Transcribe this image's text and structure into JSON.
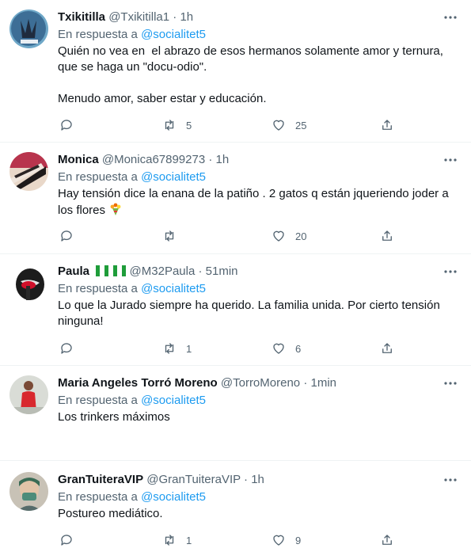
{
  "reply_prefix": "En respuesta a",
  "colors": {
    "mention": "#1d9bf0",
    "secondary": "#536471",
    "text": "#0f1419",
    "divider": "#eff3f4"
  },
  "icons": {
    "reply": "comment-icon",
    "retweet": "retweet-icon",
    "like": "heart-icon",
    "share": "share-icon",
    "more": "more-icon"
  },
  "tweets": [
    {
      "name": "Txikitilla",
      "handle": "@Txikitilla1",
      "sep": "·",
      "time": "1h",
      "mention": "@socialitet5",
      "text": "Quién no vea en  el abrazo de esos hermanos solamente amor y ternura, que se haga un \"docu-odio\".\n\nMenudo amor, saber estar y educación.",
      "replies": "",
      "retweets": "5",
      "likes": "25"
    },
    {
      "name": "Monica",
      "handle": "@Monica67899273",
      "sep": "·",
      "time": "1h",
      "mention": "@socialitet5",
      "text": "Hay tensión dice la enana de la patiño . 2 gatos q están jqueriendo joder a los flores ",
      "replies": "",
      "retweets": "",
      "likes": "20"
    },
    {
      "name": "Paula",
      "handle": "@M32Paula",
      "sep": "·",
      "time": "51min",
      "mention": "@socialitet5",
      "text": "Lo que la Jurado siempre ha querido. La familia unida. Por cierto tensión ninguna!",
      "replies": "",
      "retweets": "1",
      "likes": "6"
    },
    {
      "name": "Maria Angeles Torró Moreno",
      "handle": "@TorroMoreno",
      "sep": "·",
      "time": "1min",
      "mention": "@socialitet5",
      "text": "Los trinkers máximos",
      "replies": "",
      "retweets": "",
      "likes": ""
    },
    {
      "name": "GranTuiteraVIP",
      "handle": "@GranTuiteraVIP",
      "sep": "·",
      "time": "1h",
      "mention": "@socialitet5",
      "text": "Postureo mediático.",
      "replies": "",
      "retweets": "1",
      "likes": "9"
    }
  ]
}
